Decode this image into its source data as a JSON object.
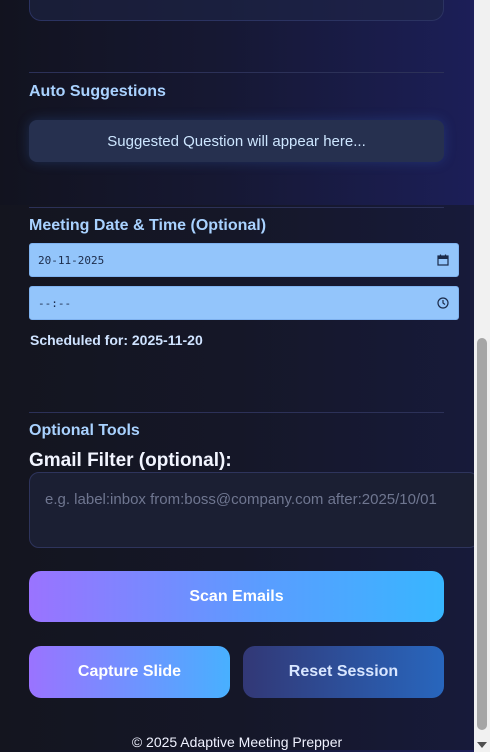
{
  "sections": {
    "auto_suggestions": {
      "title": "Auto Suggestions",
      "placeholder_text": "Suggested Question will appear here..."
    },
    "meeting": {
      "title": "Meeting Date & Time (Optional)",
      "date_value": "20-11-2025",
      "time_value": "--:--",
      "scheduled_label": "Scheduled for: 2025-11-20"
    },
    "optional_tools": {
      "title": "Optional Tools",
      "gmail_label": "Gmail Filter (optional):",
      "gmail_placeholder": "e.g. label:inbox from:boss@company.com after:2025/10/01"
    }
  },
  "buttons": {
    "scan": "Scan Emails",
    "capture": "Capture Slide",
    "reset": "Reset Session"
  },
  "footer": "© 2025 Adaptive Meeting Prepper",
  "icons": [
    "calendar-icon",
    "clock-icon"
  ],
  "colors": {
    "accent": "#a9d2ff",
    "input_bg": "#93c5fb",
    "button_gradient_start": "#9a73ff",
    "button_gradient_end": "#38b6ff"
  }
}
